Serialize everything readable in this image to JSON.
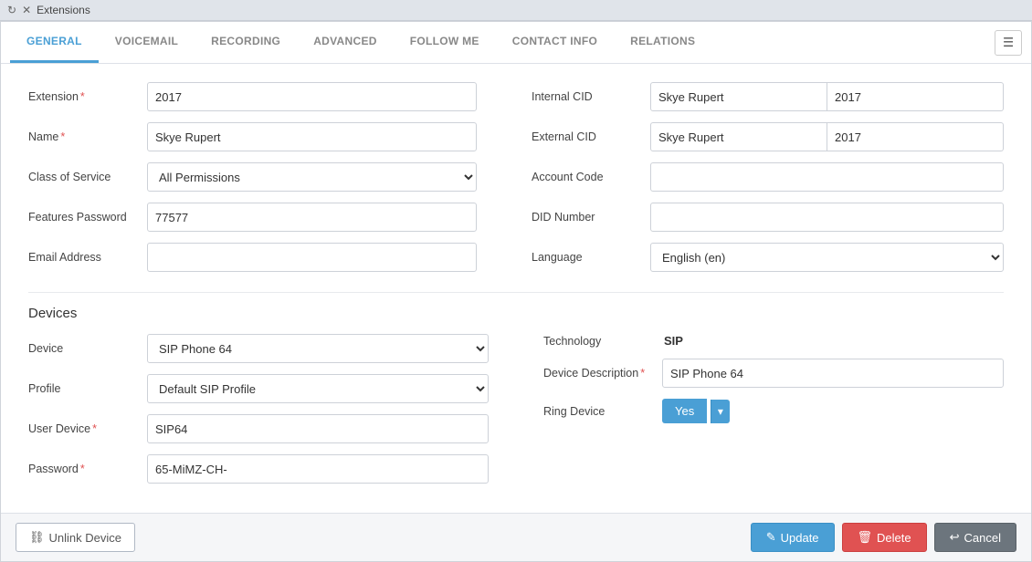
{
  "window": {
    "title": "Extensions"
  },
  "tabs": [
    {
      "id": "general",
      "label": "GENERAL",
      "active": true
    },
    {
      "id": "voicemail",
      "label": "VOICEMAIL",
      "active": false
    },
    {
      "id": "recording",
      "label": "RECORDING",
      "active": false
    },
    {
      "id": "advanced",
      "label": "ADVANCED",
      "active": false
    },
    {
      "id": "follow-me",
      "label": "FOLLOW ME",
      "active": false
    },
    {
      "id": "contact-info",
      "label": "CONTACT INFO",
      "active": false
    },
    {
      "id": "relations",
      "label": "RELATIONS",
      "active": false
    }
  ],
  "form": {
    "extension_label": "Extension",
    "extension_value": "2017",
    "name_label": "Name",
    "name_value": "Skye Rupert",
    "cos_label": "Class of Service",
    "cos_value": "All Permissions",
    "features_label": "Features Password",
    "features_value": "77577",
    "email_label": "Email Address",
    "email_value": "",
    "internal_cid_label": "Internal CID",
    "internal_cid_name": "Skye Rupert",
    "internal_cid_ext": "2017",
    "external_cid_label": "External CID",
    "external_cid_name": "Skye Rupert",
    "external_cid_ext": "2017",
    "account_code_label": "Account Code",
    "account_code_value": "",
    "did_number_label": "DID Number",
    "did_number_value": "",
    "language_label": "Language",
    "language_value": "English (en)"
  },
  "devices": {
    "section_title": "Devices",
    "device_label": "Device",
    "device_value": "SIP Phone 64",
    "profile_label": "Profile",
    "profile_value": "Default SIP Profile",
    "user_device_label": "User Device",
    "user_device_value": "SIP64",
    "password_label": "Password",
    "password_value": "65-MiMZ-CH-",
    "technology_label": "Technology",
    "technology_value": "SIP",
    "device_desc_label": "Device Description",
    "device_desc_value": "SIP Phone 64",
    "ring_device_label": "Ring Device",
    "ring_device_value": "Yes"
  },
  "buttons": {
    "unlink": "Unlink Device",
    "update": "Update",
    "delete": "Delete",
    "cancel": "Cancel"
  },
  "icons": {
    "refresh": "↻",
    "close": "✕",
    "menu": "☰",
    "unlink": "⛓",
    "pencil": "✎",
    "trash": "🗑",
    "undo": "↩"
  }
}
